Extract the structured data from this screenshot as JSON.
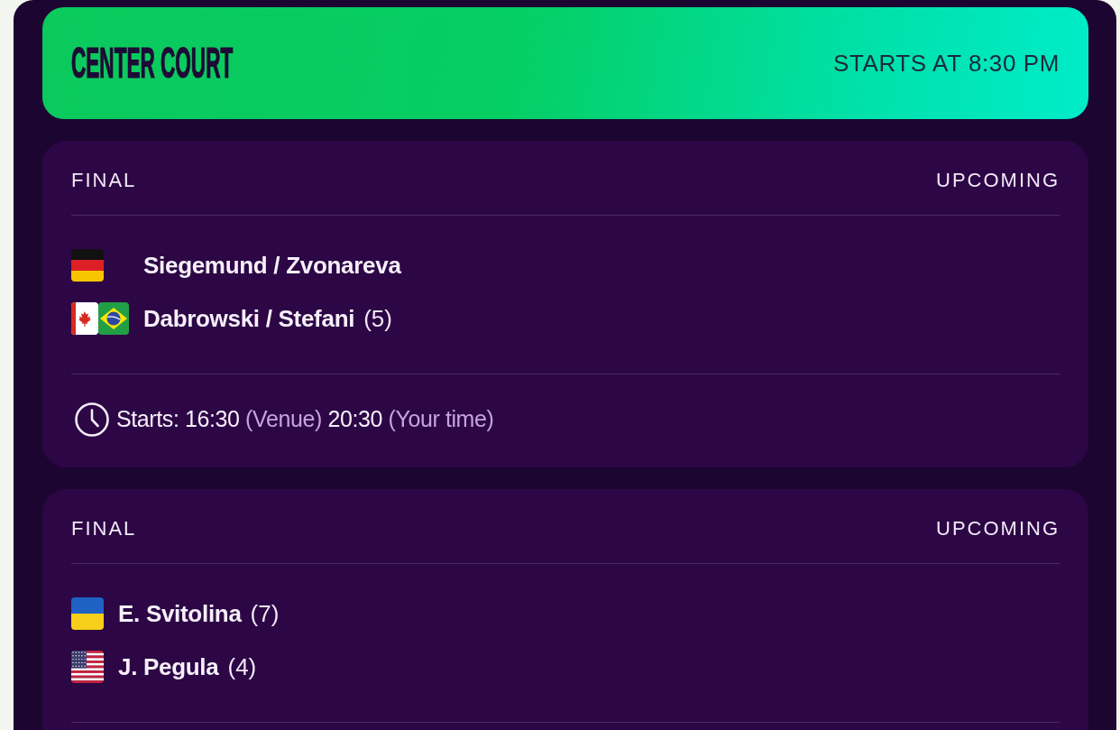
{
  "court": {
    "name": "CENTER COURT",
    "start": "STARTS AT 8:30 PM"
  },
  "matches": [
    {
      "round": "FINAL",
      "status": "UPCOMING",
      "teams": [
        {
          "flags": [
            {
              "kind": "germany"
            }
          ],
          "name": "Siegemund / Zvonareva"
        },
        {
          "flags": [
            {
              "kind": "canada"
            },
            {
              "kind": "brazil"
            }
          ],
          "name": "Dabrowski / Stefani",
          "seed": "(5)"
        }
      ],
      "start": {
        "label": "Starts:",
        "venue_time": "16:30",
        "venue_note": "(Venue)",
        "local_time": "20:30",
        "local_note": "(Your time)"
      }
    },
    {
      "round": "FINAL",
      "status": "UPCOMING",
      "teams": [
        {
          "flags": [
            {
              "kind": "ukraine"
            }
          ],
          "name": "E. Svitolina",
          "seed": "(7)"
        },
        {
          "flags": [
            {
              "kind": "usa"
            }
          ],
          "name": "J. Pegula",
          "seed": "(4)"
        }
      ]
    }
  ]
}
